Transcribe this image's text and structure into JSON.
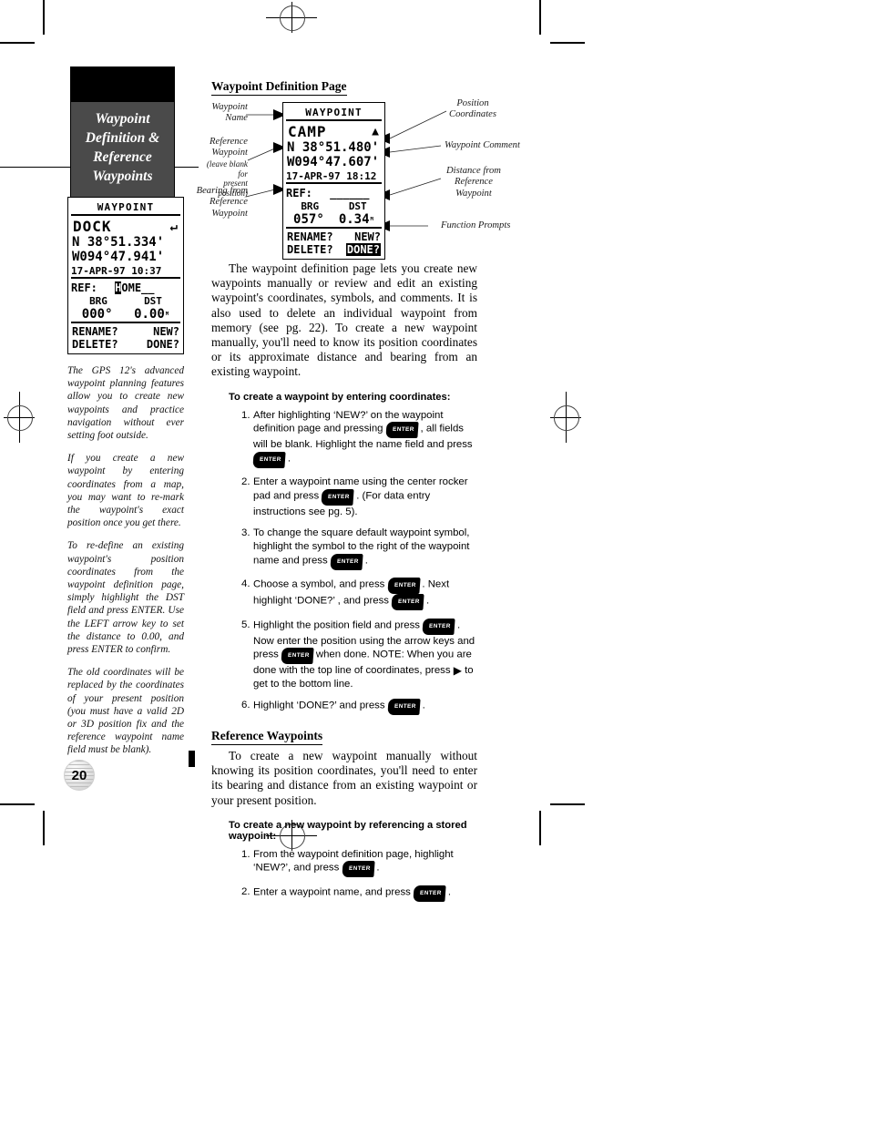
{
  "chapter_tab": {
    "lines": [
      "Waypoint",
      "Definition &",
      "Reference",
      "Waypoints"
    ]
  },
  "page_number": "20",
  "sidebar": {
    "gps_screen": {
      "title": "WAYPOINT",
      "name": "DOCK",
      "symbol_icon": "return-arrow-icon",
      "lat": "N  38°51.334'",
      "lon": "W094°47.941'",
      "datetime": "17-APR-97 10:37",
      "ref_label": "REF:",
      "ref_value_highlighted": "H",
      "ref_value_rest": "OME__",
      "brg_label": "BRG",
      "dst_label": "DST",
      "brg_value": "000°",
      "dst_value": "0.00",
      "dst_unit": "ᴹ",
      "prompts": [
        "RENAME?",
        "NEW?",
        "DELETE?",
        "DONE?"
      ]
    },
    "notes": [
      "The GPS 12's advanced waypoint planning features allow you to create new waypoints and practice navigation without ever setting foot outside.",
      "If you create a new waypoint by entering coordinates from a map, you may want to re-mark the waypoint's exact position once you get there.",
      "To re-define an existing waypoint's position coordinates from the waypoint definition page, simply highlight the DST field and press ENTER. Use the LEFT arrow key to set the distance to 0.00, and press ENTER to confirm.",
      "The old coordinates will be replaced by the coordinates of your present position (you must have a valid 2D or 3D position fix and the reference waypoint name field must be blank)."
    ]
  },
  "diagram": {
    "gps_screen": {
      "title": "WAYPOINT",
      "name": "CAMP",
      "symbol_icon": "tent-icon",
      "lat": "N  38°51.480'",
      "lon": "W094°47.607'",
      "datetime": "17-APR-97 18:12",
      "ref_label": "REF:",
      "ref_value": "______",
      "brg_label": "BRG",
      "dst_label": "DST",
      "brg_value": "057°",
      "dst_value": "0.34",
      "dst_unit": "ᴹ",
      "prompts": [
        "RENAME?",
        "NEW?",
        "DELETE?",
        "DONE?"
      ],
      "highlighted_prompt": "DONE?"
    },
    "callouts_left": [
      {
        "lines": [
          "Waypoint",
          "Name"
        ]
      },
      {
        "lines": [
          "Reference",
          "Waypoint"
        ],
        "small": [
          "(leave blank for",
          "present position)"
        ]
      },
      {
        "lines": [
          "Bearing from",
          "Reference",
          "Waypoint"
        ]
      }
    ],
    "callouts_right": [
      {
        "lines": [
          "Position",
          "Coordinates"
        ]
      },
      {
        "lines": [
          "Waypoint Comment"
        ]
      },
      {
        "lines": [
          "Distance from",
          "Reference",
          "Waypoint"
        ]
      },
      {
        "lines": [
          "Function Prompts"
        ]
      }
    ]
  },
  "main": {
    "heading_1": "Waypoint Definition Page",
    "paragraph_1": "The waypoint definition page lets you create new waypoints manually or review and edit an existing waypoint's coordinates, symbols, and comments. It is also used to delete an individual waypoint from memory (see pg. 22). To create a new waypoint manually, you'll need to know its position coordinates or its approximate distance and bearing from an existing waypoint.",
    "subheading_1": "To create a waypoint by entering coordinates:",
    "steps_1": [
      {
        "n": "1.",
        "a": "After highlighting ‘NEW?’ on the waypoint definition page and pressing",
        "key": "ENTER",
        "b": ", all fields will be blank. Highlight the name field and press",
        "key2": "ENTER",
        "c": "."
      },
      {
        "n": "2.",
        "a": "Enter a waypoint name using the center rocker pad and press",
        "key": "ENTER",
        "b": ". (For data entry instructions see pg. 5)."
      },
      {
        "n": "3.",
        "a": "To change the square default waypoint symbol, highlight the symbol to the right of the waypoint name and press",
        "key": "ENTER",
        "b": "."
      },
      {
        "n": "4.",
        "a": "Choose a symbol, and press",
        "key": "ENTER",
        "b": ". Next highlight ‘DONE?’ , and press",
        "key2": "ENTER",
        "c": "."
      },
      {
        "n": "5.",
        "a": "Highlight the position field and press",
        "key": "ENTER",
        "b": ". Now enter the position using the arrow keys and press",
        "key2": "ENTER",
        "c": "when done. NOTE: When you are done with the top line of coordinates, press",
        "arrow": "▶",
        "d": "to get to the bottom line."
      },
      {
        "n": "6.",
        "a": "Highlight ‘DONE?’ and press",
        "key": "ENTER",
        "b": "."
      }
    ],
    "heading_2": "Reference Waypoints",
    "paragraph_2": "To create a new waypoint manually without knowing its position coordinates, you'll need to enter its bearing and distance from an existing waypoint or your present position.",
    "subheading_2": "To create a new waypoint by referencing a stored waypoint:",
    "steps_2": [
      {
        "n": "1.",
        "a": "From the waypoint definition page, highlight ‘NEW?’, and press",
        "key": "ENTER",
        "b": "."
      },
      {
        "n": "2.",
        "a": "Enter a waypoint name, and press",
        "key": "ENTER",
        "b": "."
      }
    ]
  }
}
